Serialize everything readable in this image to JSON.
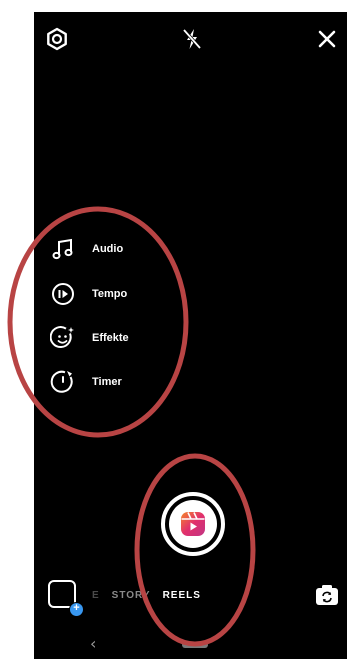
{
  "top_bar": {
    "settings_icon": "gear-icon",
    "flash_icon": "flash-off-icon",
    "close_icon": "close-icon"
  },
  "tools": [
    {
      "label": "Audio",
      "icon": "music-note-icon"
    },
    {
      "label": "Tempo",
      "icon": "speed-icon"
    },
    {
      "label": "Effekte",
      "icon": "effects-smiley-icon"
    },
    {
      "label": "Timer",
      "icon": "timer-icon"
    }
  ],
  "modes": {
    "previous_partial": "E",
    "story": "STORY",
    "active": "REELS"
  },
  "shutter": {
    "icon": "reels-icon"
  },
  "gallery": {
    "icon": "gallery-add-icon",
    "badge": "+"
  },
  "flip_camera": {
    "icon": "flip-camera-icon"
  },
  "nav": {
    "back_glyph": "‹"
  },
  "colors": {
    "background": "#000000",
    "annotation_red": "#b84444",
    "plus_badge": "#3897f0",
    "reels_gradient_start": "#f58529",
    "reels_gradient_end": "#dd2a7b"
  }
}
